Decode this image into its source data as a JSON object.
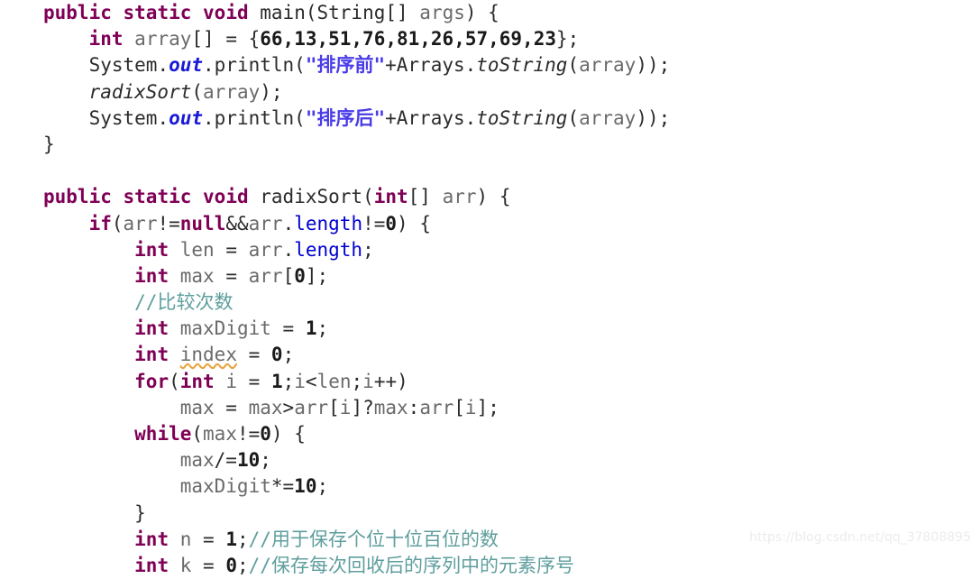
{
  "document": {
    "type": "java-source-code-screenshot",
    "language": "Java",
    "background_color": "#ffffff"
  },
  "theme": {
    "keyword_color": "#7f0055",
    "identifier_color": "#6a6a6a",
    "string_color": "#4a3ce8",
    "comment_color": "#5f9e9e",
    "field_color": "#0000d0",
    "static_field_color": "#1a1ad6",
    "number_color": "#1a1a1a",
    "punctuation_color": "#2b2b2b",
    "warning_underline_color": "#e8a33d",
    "watermark_color": "#ececec"
  },
  "watermark": {
    "text": "https://blog.csdn.net/qq_37808895"
  },
  "code": {
    "lines": [
      {
        "index": 1,
        "indent": 0,
        "text": "public static void main(String[] args) {",
        "tokens": [
          {
            "text": "public",
            "kind": "keyword"
          },
          {
            "text": " ",
            "kind": "plain"
          },
          {
            "text": "static",
            "kind": "keyword"
          },
          {
            "text": " ",
            "kind": "plain"
          },
          {
            "text": "void",
            "kind": "keyword"
          },
          {
            "text": " ",
            "kind": "plain"
          },
          {
            "text": "main",
            "kind": "plain"
          },
          {
            "text": "(",
            "kind": "punct"
          },
          {
            "text": "String",
            "kind": "plain"
          },
          {
            "text": "[] ",
            "kind": "punct"
          },
          {
            "text": "args",
            "kind": "identifier"
          },
          {
            "text": ") {",
            "kind": "punct"
          }
        ]
      },
      {
        "index": 2,
        "indent": 1,
        "text": "int array[] = {66,13,51,76,81,26,57,69,23};",
        "tokens": [
          {
            "text": "int",
            "kind": "keyword"
          },
          {
            "text": " ",
            "kind": "plain"
          },
          {
            "text": "array",
            "kind": "identifier"
          },
          {
            "text": "[] ",
            "kind": "punct"
          },
          {
            "text": "= {",
            "kind": "punct"
          },
          {
            "text": "66,13,51,76,81,26,57,69,23",
            "kind": "number"
          },
          {
            "text": "};",
            "kind": "punct"
          }
        ]
      },
      {
        "index": 3,
        "indent": 1,
        "text": "System.out.println(\"排序前\"+Arrays.toString(array));",
        "tokens": [
          {
            "text": "System",
            "kind": "plain"
          },
          {
            "text": ".",
            "kind": "punct"
          },
          {
            "text": "out",
            "kind": "static-field"
          },
          {
            "text": ".println(",
            "kind": "punct"
          },
          {
            "text": "\"排序前\"",
            "kind": "string"
          },
          {
            "text": "+Arrays.",
            "kind": "punct"
          },
          {
            "text": "toString",
            "kind": "method-italic"
          },
          {
            "text": "(",
            "kind": "punct"
          },
          {
            "text": "array",
            "kind": "identifier"
          },
          {
            "text": "));",
            "kind": "punct"
          }
        ]
      },
      {
        "index": 4,
        "indent": 1,
        "text": "radixSort(array);",
        "tokens": [
          {
            "text": "radixSort",
            "kind": "method-italic"
          },
          {
            "text": "(",
            "kind": "punct"
          },
          {
            "text": "array",
            "kind": "identifier"
          },
          {
            "text": ");",
            "kind": "punct"
          }
        ]
      },
      {
        "index": 5,
        "indent": 1,
        "text": "System.out.println(\"排序后\"+Arrays.toString(array));",
        "tokens": [
          {
            "text": "System",
            "kind": "plain"
          },
          {
            "text": ".",
            "kind": "punct"
          },
          {
            "text": "out",
            "kind": "static-field"
          },
          {
            "text": ".println(",
            "kind": "punct"
          },
          {
            "text": "\"排序后\"",
            "kind": "string"
          },
          {
            "text": "+Arrays.",
            "kind": "punct"
          },
          {
            "text": "toString",
            "kind": "method-italic"
          },
          {
            "text": "(",
            "kind": "punct"
          },
          {
            "text": "array",
            "kind": "identifier"
          },
          {
            "text": "));",
            "kind": "punct"
          }
        ]
      },
      {
        "index": 6,
        "indent": 0,
        "text": "}",
        "tokens": [
          {
            "text": "}",
            "kind": "punct"
          }
        ]
      },
      {
        "index": 7,
        "indent": 0,
        "text": "",
        "tokens": []
      },
      {
        "index": 8,
        "indent": 0,
        "text": "public static void radixSort(int[] arr) {",
        "tokens": [
          {
            "text": "public",
            "kind": "keyword"
          },
          {
            "text": " ",
            "kind": "plain"
          },
          {
            "text": "static",
            "kind": "keyword"
          },
          {
            "text": " ",
            "kind": "plain"
          },
          {
            "text": "void",
            "kind": "keyword"
          },
          {
            "text": " ",
            "kind": "plain"
          },
          {
            "text": "radixSort",
            "kind": "plain"
          },
          {
            "text": "(",
            "kind": "punct"
          },
          {
            "text": "int",
            "kind": "keyword"
          },
          {
            "text": "[] ",
            "kind": "punct"
          },
          {
            "text": "arr",
            "kind": "identifier"
          },
          {
            "text": ") {",
            "kind": "punct"
          }
        ]
      },
      {
        "index": 9,
        "indent": 1,
        "text": "if(arr!=null&&arr.length!=0) {",
        "tokens": [
          {
            "text": "if",
            "kind": "keyword"
          },
          {
            "text": "(",
            "kind": "punct"
          },
          {
            "text": "arr",
            "kind": "identifier"
          },
          {
            "text": "!=",
            "kind": "punct"
          },
          {
            "text": "null",
            "kind": "keyword"
          },
          {
            "text": "&&",
            "kind": "punct"
          },
          {
            "text": "arr",
            "kind": "identifier"
          },
          {
            "text": ".",
            "kind": "punct"
          },
          {
            "text": "length",
            "kind": "field"
          },
          {
            "text": "!=",
            "kind": "punct"
          },
          {
            "text": "0",
            "kind": "number"
          },
          {
            "text": ") {",
            "kind": "punct"
          }
        ]
      },
      {
        "index": 10,
        "indent": 2,
        "text": "int len = arr.length;",
        "tokens": [
          {
            "text": "int",
            "kind": "keyword"
          },
          {
            "text": " ",
            "kind": "plain"
          },
          {
            "text": "len",
            "kind": "identifier"
          },
          {
            "text": " = ",
            "kind": "punct"
          },
          {
            "text": "arr",
            "kind": "identifier"
          },
          {
            "text": ".",
            "kind": "punct"
          },
          {
            "text": "length",
            "kind": "field"
          },
          {
            "text": ";",
            "kind": "punct"
          }
        ]
      },
      {
        "index": 11,
        "indent": 2,
        "text": "int max = arr[0];",
        "tokens": [
          {
            "text": "int",
            "kind": "keyword"
          },
          {
            "text": " ",
            "kind": "plain"
          },
          {
            "text": "max",
            "kind": "identifier"
          },
          {
            "text": " = ",
            "kind": "punct"
          },
          {
            "text": "arr",
            "kind": "identifier"
          },
          {
            "text": "[",
            "kind": "punct"
          },
          {
            "text": "0",
            "kind": "number"
          },
          {
            "text": "];",
            "kind": "punct"
          }
        ]
      },
      {
        "index": 12,
        "indent": 2,
        "text": "//比较次数",
        "tokens": [
          {
            "text": "//比较次数",
            "kind": "comment"
          }
        ]
      },
      {
        "index": 13,
        "indent": 2,
        "text": "int maxDigit = 1;",
        "tokens": [
          {
            "text": "int",
            "kind": "keyword"
          },
          {
            "text": " ",
            "kind": "plain"
          },
          {
            "text": "maxDigit",
            "kind": "identifier"
          },
          {
            "text": " = ",
            "kind": "punct"
          },
          {
            "text": "1",
            "kind": "number"
          },
          {
            "text": ";",
            "kind": "punct"
          }
        ]
      },
      {
        "index": 14,
        "indent": 2,
        "text": "int index = 0;",
        "tokens": [
          {
            "text": "int",
            "kind": "keyword"
          },
          {
            "text": " ",
            "kind": "plain"
          },
          {
            "text": "index",
            "kind": "warning"
          },
          {
            "text": " = ",
            "kind": "punct"
          },
          {
            "text": "0",
            "kind": "number"
          },
          {
            "text": ";",
            "kind": "punct"
          }
        ]
      },
      {
        "index": 15,
        "indent": 2,
        "text": "for(int i = 1;i<len;i++)",
        "tokens": [
          {
            "text": "for",
            "kind": "keyword"
          },
          {
            "text": "(",
            "kind": "punct"
          },
          {
            "text": "int",
            "kind": "keyword"
          },
          {
            "text": " ",
            "kind": "plain"
          },
          {
            "text": "i",
            "kind": "identifier"
          },
          {
            "text": " = ",
            "kind": "punct"
          },
          {
            "text": "1",
            "kind": "number"
          },
          {
            "text": ";",
            "kind": "punct"
          },
          {
            "text": "i",
            "kind": "identifier"
          },
          {
            "text": "<",
            "kind": "punct"
          },
          {
            "text": "len",
            "kind": "identifier"
          },
          {
            "text": ";",
            "kind": "punct"
          },
          {
            "text": "i",
            "kind": "identifier"
          },
          {
            "text": "++)",
            "kind": "punct"
          }
        ]
      },
      {
        "index": 16,
        "indent": 3,
        "text": "max = max>arr[i]?max:arr[i];",
        "tokens": [
          {
            "text": "max",
            "kind": "identifier"
          },
          {
            "text": " = ",
            "kind": "punct"
          },
          {
            "text": "max",
            "kind": "identifier"
          },
          {
            "text": ">",
            "kind": "punct"
          },
          {
            "text": "arr",
            "kind": "identifier"
          },
          {
            "text": "[",
            "kind": "punct"
          },
          {
            "text": "i",
            "kind": "identifier"
          },
          {
            "text": "]?",
            "kind": "punct"
          },
          {
            "text": "max",
            "kind": "identifier"
          },
          {
            "text": ":",
            "kind": "punct"
          },
          {
            "text": "arr",
            "kind": "identifier"
          },
          {
            "text": "[",
            "kind": "punct"
          },
          {
            "text": "i",
            "kind": "identifier"
          },
          {
            "text": "];",
            "kind": "punct"
          }
        ]
      },
      {
        "index": 17,
        "indent": 2,
        "text": "while(max!=0) {",
        "tokens": [
          {
            "text": "while",
            "kind": "keyword"
          },
          {
            "text": "(",
            "kind": "punct"
          },
          {
            "text": "max",
            "kind": "identifier"
          },
          {
            "text": "!=",
            "kind": "punct"
          },
          {
            "text": "0",
            "kind": "number"
          },
          {
            "text": ") {",
            "kind": "punct"
          }
        ]
      },
      {
        "index": 18,
        "indent": 3,
        "text": "max/=10;",
        "tokens": [
          {
            "text": "max",
            "kind": "identifier"
          },
          {
            "text": "/=",
            "kind": "punct"
          },
          {
            "text": "10",
            "kind": "number"
          },
          {
            "text": ";",
            "kind": "punct"
          }
        ]
      },
      {
        "index": 19,
        "indent": 3,
        "text": "maxDigit*=10;",
        "tokens": [
          {
            "text": "maxDigit",
            "kind": "identifier"
          },
          {
            "text": "*=",
            "kind": "punct"
          },
          {
            "text": "10",
            "kind": "number"
          },
          {
            "text": ";",
            "kind": "punct"
          }
        ]
      },
      {
        "index": 20,
        "indent": 2,
        "text": "}",
        "tokens": [
          {
            "text": "}",
            "kind": "punct"
          }
        ]
      },
      {
        "index": 21,
        "indent": 2,
        "text": "int n = 1;//用于保存个位十位百位的数",
        "tokens": [
          {
            "text": "int",
            "kind": "keyword"
          },
          {
            "text": " ",
            "kind": "plain"
          },
          {
            "text": "n",
            "kind": "identifier"
          },
          {
            "text": " = ",
            "kind": "punct"
          },
          {
            "text": "1",
            "kind": "number"
          },
          {
            "text": ";",
            "kind": "punct"
          },
          {
            "text": "//用于保存个位十位百位的数",
            "kind": "comment"
          }
        ]
      },
      {
        "index": 22,
        "indent": 2,
        "text": "int k = 0;//保存每次回收后的序列中的元素序号",
        "tokens": [
          {
            "text": "int",
            "kind": "keyword"
          },
          {
            "text": " ",
            "kind": "plain"
          },
          {
            "text": "k",
            "kind": "identifier"
          },
          {
            "text": " = ",
            "kind": "punct"
          },
          {
            "text": "0",
            "kind": "number"
          },
          {
            "text": ";",
            "kind": "punct"
          },
          {
            "text": "//保存每次回收后的序列中的元素序号",
            "kind": "comment"
          }
        ]
      }
    ]
  }
}
